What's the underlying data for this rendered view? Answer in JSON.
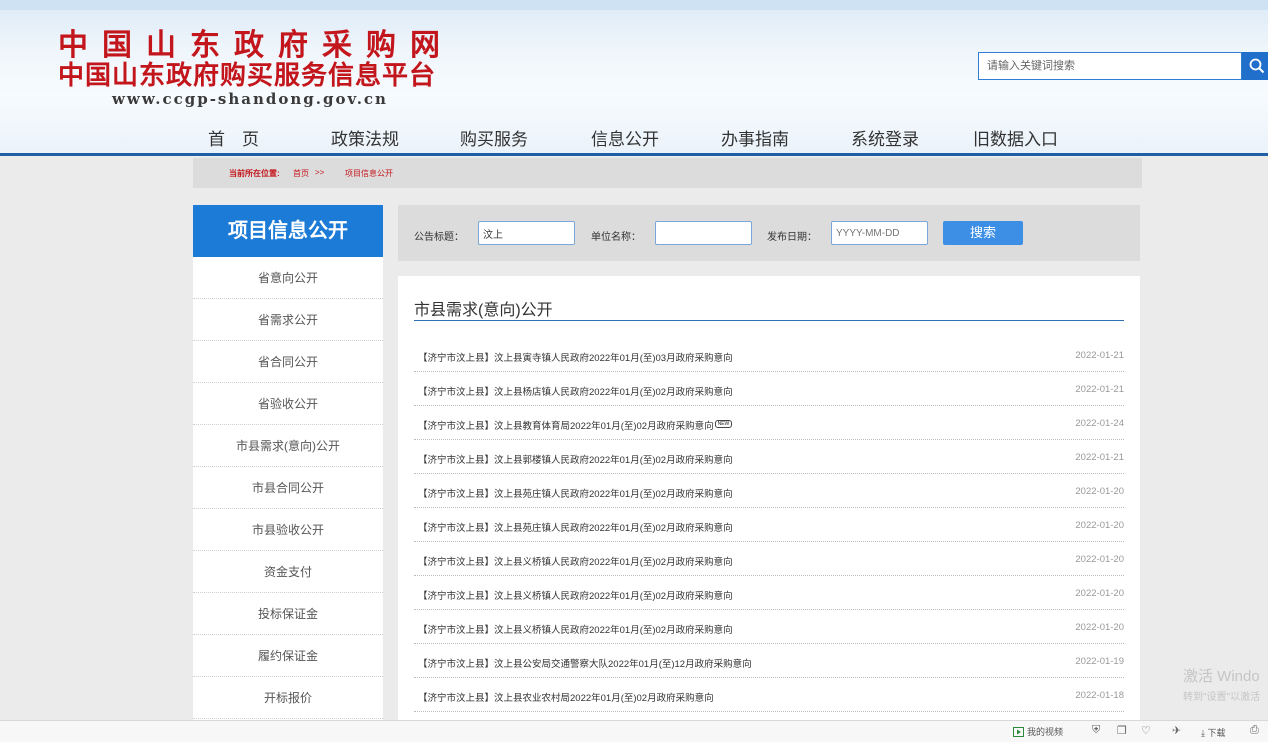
{
  "header": {
    "logo_line1": "中国山东政府采购网",
    "logo_line2": "中国山东政府购买服务信息平台",
    "logo_url": "www.ccgp-shandong.gov.cn",
    "search_placeholder": "请输入关键词搜索",
    "search_icon": "search-icon"
  },
  "nav": {
    "items": [
      "首　页",
      "政策法规",
      "购买服务",
      "信息公开",
      "办事指南",
      "系统登录",
      "旧数据入口"
    ]
  },
  "breadcrumb": {
    "label": "当前所在位置:",
    "home": "首页",
    "separator": ">>",
    "current": "项目信息公开"
  },
  "sidebar": {
    "title": "项目信息公开",
    "items": [
      "省意向公开",
      "省需求公开",
      "省合同公开",
      "省验收公开",
      "市县需求(意向)公开",
      "市县合同公开",
      "市县验收公开",
      "资金支付",
      "投标保证金",
      "履约保证金",
      "开标报价"
    ]
  },
  "filter": {
    "title_label": "公告标题：",
    "title_value": "汶上",
    "unit_label": "单位名称：",
    "unit_value": "",
    "date_label": "发布日期：",
    "date_placeholder": "YYYY-MM-DD",
    "search_button": "搜索"
  },
  "panel": {
    "title": "市县需求(意向)公开",
    "new_badge": "NEW",
    "rows": [
      {
        "title": "【济宁市汶上县】汶上县寅寺镇人民政府2022年01月(至)03月政府采购意向",
        "date": "2022-01-21"
      },
      {
        "title": "【济宁市汶上县】汶上县杨店镇人民政府2022年01月(至)02月政府采购意向",
        "date": "2022-01-21"
      },
      {
        "title": "【济宁市汶上县】汶上县教育体育局2022年01月(至)02月政府采购意向",
        "date": "2022-01-24"
      },
      {
        "title": "【济宁市汶上县】汶上县郭楼镇人民政府2022年01月(至)02月政府采购意向",
        "date": "2022-01-21"
      },
      {
        "title": "【济宁市汶上县】汶上县苑庄镇人民政府2022年01月(至)02月政府采购意向",
        "date": "2022-01-20"
      },
      {
        "title": "【济宁市汶上县】汶上县苑庄镇人民政府2022年01月(至)02月政府采购意向",
        "date": "2022-01-20"
      },
      {
        "title": "【济宁市汶上县】汶上县义桥镇人民政府2022年01月(至)02月政府采购意向",
        "date": "2022-01-20"
      },
      {
        "title": "【济宁市汶上县】汶上县义桥镇人民政府2022年01月(至)02月政府采购意向",
        "date": "2022-01-20"
      },
      {
        "title": "【济宁市汶上县】汶上县义桥镇人民政府2022年01月(至)02月政府采购意向",
        "date": "2022-01-20"
      },
      {
        "title": "【济宁市汶上县】汶上县公安局交通警察大队2022年01月(至)12月政府采购意向",
        "date": "2022-01-19"
      },
      {
        "title": "【济宁市汶上县】汶上县农业农村局2022年01月(至)02月政府采购意向",
        "date": "2022-01-18"
      }
    ]
  },
  "watermark": {
    "line1": "激活 Windo",
    "line2": "转到\"设置\"以激活"
  },
  "statusbar": {
    "video": "我的视频",
    "download": "下载"
  },
  "colors": {
    "brand_red": "#c3161c",
    "brand_blue": "#1c7bd7",
    "nav_line": "#1f5fa6"
  }
}
